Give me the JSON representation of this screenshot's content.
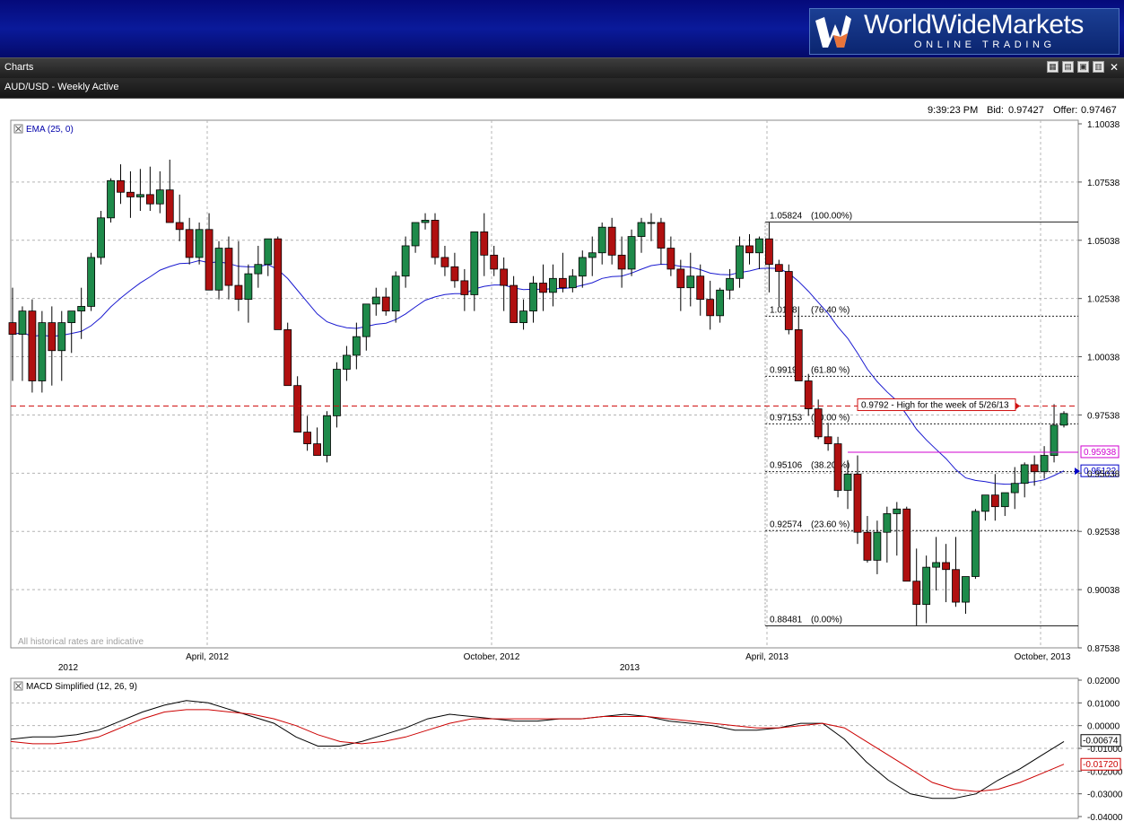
{
  "brand": {
    "name": "WorldWideMarkets",
    "tagline": "ONLINE TRADING",
    "colors": {
      "header": "#0a1a9a",
      "logo_bg": "#1b3f94",
      "accent_orange": "#e8743b"
    }
  },
  "window": {
    "title": "Charts",
    "subtitle": "AUD/USD - Weekly Active",
    "toolbar_icons": [
      "chart-settings-icon",
      "chart-type-icon",
      "print-icon",
      "export-icon",
      "close-icon"
    ],
    "close_glyph": "✕"
  },
  "quote": {
    "time": "9:39:23 PM",
    "bid_label": "Bid:",
    "bid": "0.97427",
    "offer_label": "Offer:",
    "offer": "0.97467"
  },
  "price_panel": {
    "indicator_label": "EMA (25, 0)",
    "watermark": "All historical rates are indicative",
    "yaxis_ticks": [
      "1.10038",
      "1.07538",
      "1.05038",
      "1.02538",
      "1.00038",
      "0.97538",
      "0.95038",
      "0.92538",
      "0.90038",
      "0.87538"
    ],
    "xaxis_labels": [
      "April, 2012",
      "October, 2012",
      "April, 2013",
      "October, 2013"
    ],
    "year_labels": [
      "2012",
      "2013"
    ],
    "fibonacci": [
      {
        "price": 1.05824,
        "label": "1.05824",
        "pct": "(100.00%)"
      },
      {
        "price": 1.01778,
        "label": "1.0178",
        "pct": "(76.40 %)"
      },
      {
        "price": 0.99199,
        "label": "0.99199",
        "pct": "(61.80 %)"
      },
      {
        "price": 0.97153,
        "label": "0.97153",
        "pct": "(50.00 %)"
      },
      {
        "price": 0.95106,
        "label": "0.95106",
        "pct": "(38.20 %)"
      },
      {
        "price": 0.92574,
        "label": "0.92574",
        "pct": "(23.60 %)"
      },
      {
        "price": 0.88481,
        "label": "0.88481",
        "pct": "(0.00%)"
      }
    ],
    "annotation": {
      "text": "0.9792 - High for the week of 5/26/13",
      "price": 0.9792
    },
    "horizontal_line": {
      "price": 0.95938,
      "label": "0.95938",
      "color": "#d000d0"
    },
    "ema_marker": {
      "price": 0.95122,
      "label": "0.95122",
      "color": "#0000c8"
    }
  },
  "macd_panel": {
    "label": "MACD Simplified (12, 26, 9)",
    "yaxis_ticks": [
      "0.02000",
      "0.01000",
      "0.00000",
      "-0.01000",
      "-0.02000",
      "-0.03000",
      "-0.04000"
    ],
    "macd_marker": "-0.00674",
    "signal_marker": "-0.01720"
  },
  "chart_data": [
    {
      "type": "candlestick",
      "title": "AUD/USD - Weekly Active",
      "ylim": [
        0.87538,
        1.10038
      ],
      "x": "weeks, Dec 2011 – Oct 2013 (index 0..97)",
      "candles_ohlc": [
        [
          1.015,
          1.03,
          0.99,
          1.01
        ],
        [
          1.01,
          1.022,
          0.99,
          1.02
        ],
        [
          1.02,
          1.025,
          0.985,
          0.99
        ],
        [
          0.99,
          1.02,
          0.985,
          1.015
        ],
        [
          1.015,
          1.022,
          0.988,
          1.003
        ],
        [
          1.003,
          1.02,
          0.99,
          1.015
        ],
        [
          1.015,
          1.02,
          1.002,
          1.02
        ],
        [
          1.02,
          1.03,
          1.008,
          1.022
        ],
        [
          1.022,
          1.045,
          1.02,
          1.043
        ],
        [
          1.043,
          1.063,
          1.04,
          1.06
        ],
        [
          1.06,
          1.077,
          1.058,
          1.076
        ],
        [
          1.076,
          1.083,
          1.066,
          1.071
        ],
        [
          1.071,
          1.08,
          1.06,
          1.069
        ],
        [
          1.069,
          1.081,
          1.063,
          1.07
        ],
        [
          1.07,
          1.082,
          1.063,
          1.066
        ],
        [
          1.066,
          1.08,
          1.062,
          1.072
        ],
        [
          1.072,
          1.085,
          1.063,
          1.058
        ],
        [
          1.058,
          1.07,
          1.05,
          1.055
        ],
        [
          1.055,
          1.06,
          1.04,
          1.043
        ],
        [
          1.043,
          1.058,
          1.04,
          1.055
        ],
        [
          1.055,
          1.062,
          1.035,
          1.029
        ],
        [
          1.029,
          1.05,
          1.025,
          1.047
        ],
        [
          1.047,
          1.052,
          1.025,
          1.031
        ],
        [
          1.031,
          1.05,
          1.02,
          1.025
        ],
        [
          1.025,
          1.04,
          1.015,
          1.036
        ],
        [
          1.036,
          1.048,
          1.03,
          1.04
        ],
        [
          1.04,
          1.05,
          1.035,
          1.051
        ],
        [
          1.051,
          1.052,
          1.015,
          1.012
        ],
        [
          1.012,
          1.015,
          0.99,
          0.988
        ],
        [
          0.988,
          0.992,
          0.97,
          0.968
        ],
        [
          0.968,
          0.975,
          0.96,
          0.963
        ],
        [
          0.963,
          0.97,
          0.958,
          0.958
        ],
        [
          0.958,
          0.977,
          0.955,
          0.975
        ],
        [
          0.975,
          0.998,
          0.97,
          0.995
        ],
        [
          0.995,
          1.005,
          0.99,
          1.001
        ],
        [
          1.001,
          1.015,
          0.995,
          1.009
        ],
        [
          1.009,
          1.023,
          1.003,
          1.023
        ],
        [
          1.023,
          1.03,
          1.018,
          1.026
        ],
        [
          1.026,
          1.03,
          1.018,
          1.02
        ],
        [
          1.02,
          1.037,
          1.015,
          1.035
        ],
        [
          1.035,
          1.052,
          1.03,
          1.048
        ],
        [
          1.048,
          1.055,
          1.045,
          1.058
        ],
        [
          1.058,
          1.062,
          1.055,
          1.059
        ],
        [
          1.059,
          1.062,
          1.04,
          1.043
        ],
        [
          1.043,
          1.048,
          1.035,
          1.039
        ],
        [
          1.039,
          1.045,
          1.03,
          1.033
        ],
        [
          1.033,
          1.038,
          1.02,
          1.027
        ],
        [
          1.027,
          1.045,
          1.02,
          1.054
        ],
        [
          1.054,
          1.062,
          1.035,
          1.044
        ],
        [
          1.044,
          1.048,
          1.035,
          1.038
        ],
        [
          1.038,
          1.043,
          1.02,
          1.031
        ],
        [
          1.031,
          1.035,
          1.015,
          1.015
        ],
        [
          1.015,
          1.025,
          1.012,
          1.02
        ],
        [
          1.02,
          1.035,
          1.015,
          1.032
        ],
        [
          1.032,
          1.04,
          1.02,
          1.028
        ],
        [
          1.028,
          1.04,
          1.022,
          1.034
        ],
        [
          1.034,
          1.045,
          1.028,
          1.03
        ],
        [
          1.03,
          1.038,
          1.028,
          1.035
        ],
        [
          1.035,
          1.046,
          1.03,
          1.043
        ],
        [
          1.043,
          1.052,
          1.035,
          1.045
        ],
        [
          1.045,
          1.058,
          1.04,
          1.056
        ],
        [
          1.056,
          1.06,
          1.04,
          1.044
        ],
        [
          1.044,
          1.052,
          1.03,
          1.038
        ],
        [
          1.038,
          1.055,
          1.035,
          1.052
        ],
        [
          1.052,
          1.06,
          1.045,
          1.058
        ],
        [
          1.058,
          1.062,
          1.05,
          1.058
        ],
        [
          1.058,
          1.06,
          1.04,
          1.047
        ],
        [
          1.047,
          1.052,
          1.035,
          1.038
        ],
        [
          1.038,
          1.042,
          1.02,
          1.03
        ],
        [
          1.03,
          1.045,
          1.022,
          1.035
        ],
        [
          1.035,
          1.04,
          1.018,
          1.025
        ],
        [
          1.025,
          1.033,
          1.012,
          1.018
        ],
        [
          1.018,
          1.03,
          1.015,
          1.029
        ],
        [
          1.029,
          1.038,
          1.025,
          1.034
        ],
        [
          1.034,
          1.052,
          1.03,
          1.048
        ],
        [
          1.048,
          1.053,
          1.04,
          1.045
        ],
        [
          1.045,
          1.052,
          1.038,
          1.051
        ],
        [
          1.051,
          1.058,
          1.028,
          1.04
        ],
        [
          1.04,
          1.042,
          1.022,
          1.037
        ],
        [
          1.037,
          1.04,
          1.01,
          1.012
        ],
        [
          1.012,
          1.022,
          0.995,
          0.99
        ],
        [
          0.99,
          0.993,
          0.975,
          0.978
        ],
        [
          0.978,
          0.982,
          0.965,
          0.966
        ],
        [
          0.966,
          0.972,
          0.96,
          0.963
        ],
        [
          0.963,
          0.966,
          0.94,
          0.943
        ],
        [
          0.943,
          0.956,
          0.935,
          0.95
        ],
        [
          0.95,
          0.958,
          0.92,
          0.925
        ],
        [
          0.925,
          0.932,
          0.912,
          0.913
        ],
        [
          0.913,
          0.93,
          0.907,
          0.925
        ],
        [
          0.925,
          0.936,
          0.912,
          0.933
        ],
        [
          0.933,
          0.938,
          0.915,
          0.935
        ],
        [
          0.935,
          0.936,
          0.905,
          0.904
        ],
        [
          0.904,
          0.918,
          0.885,
          0.894
        ],
        [
          0.894,
          0.915,
          0.886,
          0.91
        ],
        [
          0.91,
          0.923,
          0.9,
          0.912
        ],
        [
          0.912,
          0.92,
          0.895,
          0.909
        ],
        [
          0.909,
          0.923,
          0.893,
          0.895
        ],
        [
          0.895,
          0.905,
          0.89,
          0.906
        ],
        [
          0.906,
          0.935,
          0.905,
          0.934
        ],
        [
          0.934,
          0.941,
          0.93,
          0.941
        ],
        [
          0.941,
          0.95,
          0.93,
          0.936
        ],
        [
          0.936,
          0.942,
          0.932,
          0.942
        ],
        [
          0.942,
          0.953,
          0.935,
          0.946
        ],
        [
          0.946,
          0.955,
          0.94,
          0.954
        ],
        [
          0.954,
          0.958,
          0.945,
          0.951
        ],
        [
          0.951,
          0.962,
          0.948,
          0.958
        ],
        [
          0.958,
          0.98,
          0.955,
          0.971
        ],
        [
          0.971,
          0.977,
          0.97,
          0.976
        ]
      ]
    },
    {
      "type": "line",
      "title": "MACD Simplified (12, 26, 9)",
      "ylim": [
        -0.04,
        0.02
      ],
      "series": [
        {
          "color": "#000000",
          "values": [
            -0.006,
            -0.005,
            -0.005,
            -0.004,
            -0.002,
            0.002,
            0.006,
            0.009,
            0.011,
            0.01,
            0.007,
            0.004,
            0.001,
            -0.005,
            -0.009,
            -0.009,
            -0.007,
            -0.004,
            -0.001,
            0.003,
            0.005,
            0.004,
            0.003,
            0.002,
            0.002,
            0.003,
            0.003,
            0.004,
            0.005,
            0.004,
            0.002,
            0.001,
            0.0,
            -0.002,
            -0.002,
            -0.001,
            0.001,
            0.001,
            -0.006,
            -0.016,
            -0.024,
            -0.03,
            -0.032,
            -0.032,
            -0.03,
            -0.024,
            -0.019,
            -0.013,
            -0.007
          ]
        },
        {
          "color": "#cc0000",
          "values": [
            -0.007,
            -0.008,
            -0.008,
            -0.007,
            -0.005,
            -0.001,
            0.003,
            0.006,
            0.007,
            0.007,
            0.006,
            0.005,
            0.003,
            0.0,
            -0.004,
            -0.007,
            -0.008,
            -0.007,
            -0.005,
            -0.002,
            0.001,
            0.003,
            0.003,
            0.003,
            0.003,
            0.003,
            0.003,
            0.004,
            0.004,
            0.004,
            0.003,
            0.002,
            0.001,
            0.0,
            -0.001,
            -0.001,
            0.0,
            0.001,
            -0.001,
            -0.007,
            -0.013,
            -0.019,
            -0.025,
            -0.028,
            -0.029,
            -0.028,
            -0.025,
            -0.021,
            -0.017
          ]
        }
      ]
    }
  ]
}
